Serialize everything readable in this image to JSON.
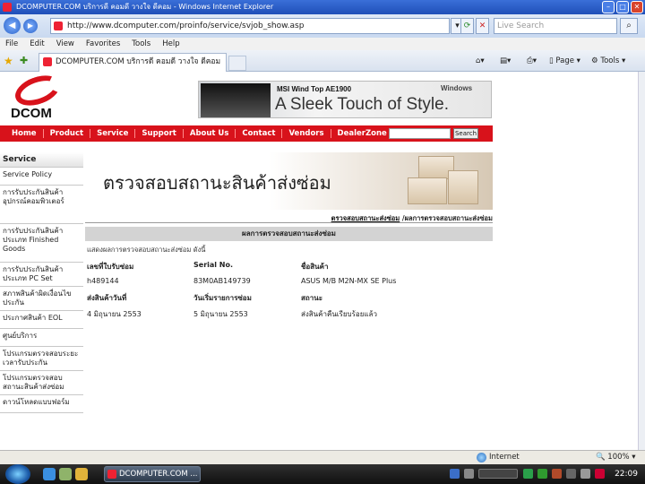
{
  "window": {
    "title": "DCOMPUTER.COM บริการดี คอมดี วางใจ ดีคอม - Windows Internet Explorer"
  },
  "addressbar": {
    "url": "http://www.dcomputer.com/proinfo/service/svjob_show.asp",
    "search_placeholder": "Live Search"
  },
  "menubar": {
    "items": [
      "File",
      "Edit",
      "View",
      "Favorites",
      "Tools",
      "Help"
    ]
  },
  "tabbar": {
    "tab_title": "DCOMPUTER.COM บริการดี คอมดี วางใจ ดีคอม",
    "page_label": "Page",
    "tools_label": "Tools"
  },
  "site": {
    "logo_text": "DCOM",
    "banner": {
      "brand": "MSI Wind Top AE1900",
      "slogan": "A Sleek Touch of Style.",
      "windows": "Windows"
    },
    "nav": [
      "Home",
      "Product",
      "Service",
      "Support",
      "About Us",
      "Contact",
      "Vendors",
      "DealerZone"
    ],
    "nav_search_button": "Search",
    "sidebar": [
      "Service",
      "Service Policy",
      "การรับประกันสินค้า อุปกรณ์คอมพิวเตอร์",
      "การรับประกันสินค้า ประเภท Finished Goods",
      "การรับประกันสินค้า ประเภท PC Set",
      "สภาพสินค้าผิดเงื่อนไขประกัน",
      "ประกาศสินค้า EOL",
      "ศูนย์บริการ",
      "โปรแกรมตรวจสอบระยะเวลารับประกัน",
      "โปรแกรมตรวจสอบสถานะสินค้าส่งซ่อม",
      "ดาวน์โหลดแบบฟอร์ม"
    ],
    "hero_title": "ตรวจสอบสถานะสินค้าส่งซ่อม",
    "breadcrumb": {
      "link": "ตรวจสอบสถานะส่งซ่อม",
      "current": "/ผลการตรวจสอบสถานะส่งซ่อม"
    },
    "result": {
      "header": "ผลการตรวจสอบสถานะส่งซ่อม",
      "note": "แสดงผลการตรวจสอบสถานะส่งซ่อม ดังนี้",
      "labels": {
        "job_no": "เลขที่ใบรับซ่อม",
        "serial": "Serial No.",
        "product": "ชื่อสินค้า",
        "send_date": "ส่งสินค้าวันที่",
        "report_date": "วันเริ่มรายการซ่อม",
        "status": "สถานะ"
      },
      "values": {
        "job_no": "h489144",
        "serial": "83M0AB149739",
        "product": "ASUS M/B M2N-MX SE Plus",
        "send_date": "4 มิถุนายน 2553",
        "report_date": "5 มิถุนายน 2553",
        "status": "ส่งสินค้าคืนเรียบร้อยแล้ว"
      }
    }
  },
  "statusbar": {
    "zone": "Internet",
    "zoom": "100%"
  },
  "taskbar": {
    "task_label": "DCOMPUTER.COM ...",
    "clock": "22:09"
  }
}
